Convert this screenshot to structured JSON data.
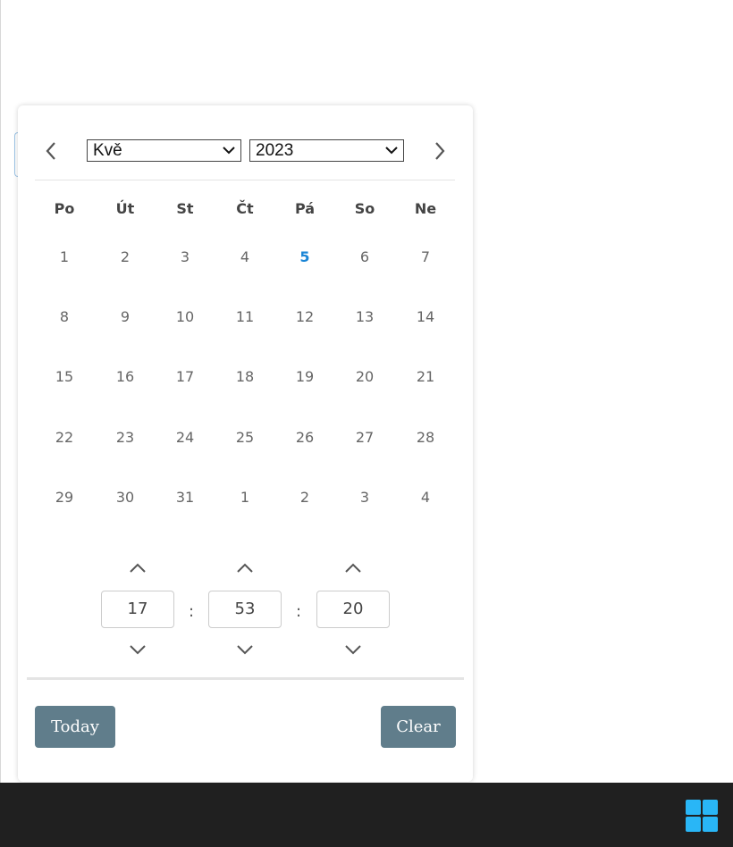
{
  "picker": {
    "month_selected": "Kvě",
    "year_selected": "2023",
    "weekdays": [
      "Po",
      "Út",
      "St",
      "Čt",
      "Pá",
      "So",
      "Ne"
    ],
    "weeks": [
      [
        "1",
        "2",
        "3",
        "4",
        "5",
        "6",
        "7"
      ],
      [
        "8",
        "9",
        "10",
        "11",
        "12",
        "13",
        "14"
      ],
      [
        "15",
        "16",
        "17",
        "18",
        "19",
        "20",
        "21"
      ],
      [
        "22",
        "23",
        "24",
        "25",
        "26",
        "27",
        "28"
      ],
      [
        "29",
        "30",
        "31",
        "1",
        "2",
        "3",
        "4"
      ]
    ],
    "highlighted_day": "5",
    "time": {
      "hours": "17",
      "minutes": "53",
      "seconds": "20",
      "separator": ":"
    },
    "today_label": "Today",
    "clear_label": "Clear"
  },
  "colors": {
    "accent": "#1a85d6",
    "button": "#607d8b",
    "taskbar": "#202020",
    "windows_logo": "#29b6f6"
  },
  "icons": [
    "chevron-left-icon",
    "chevron-right-icon",
    "chevron-up-icon",
    "chevron-down-icon",
    "windows-start-icon"
  ]
}
